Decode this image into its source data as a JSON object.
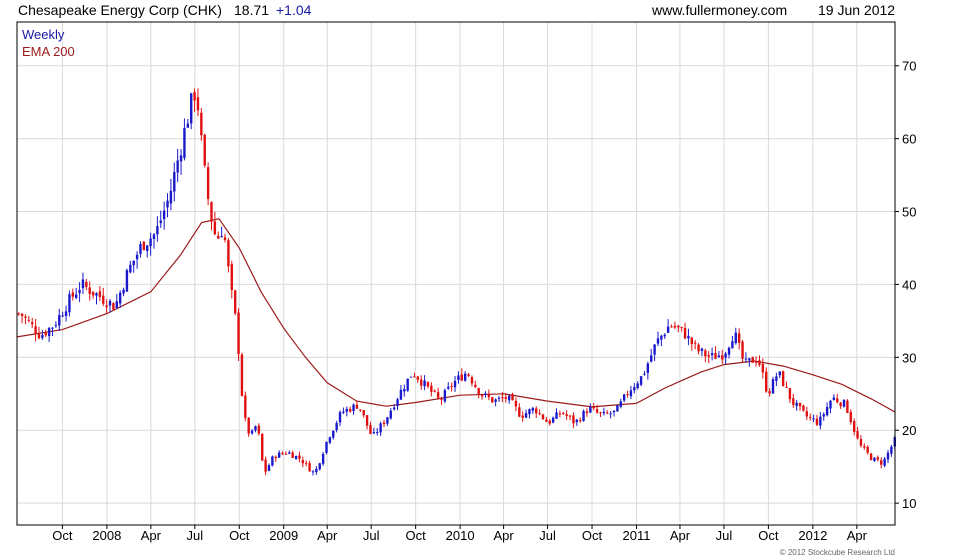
{
  "header": {
    "title": "Chesapeake Energy Corp (CHK)",
    "price": "18.71",
    "change": "+1.04",
    "site": "www.fullermoney.com",
    "date": "19 Jun 2012"
  },
  "legend": {
    "weekly": "Weekly",
    "ema": "EMA 200"
  },
  "copyright": "© 2012 Stockcube Research Ltd",
  "colors": {
    "up": "#1a1acc",
    "down": "#e01010",
    "ema": "#9b1b1b",
    "grid": "#d9d9d9"
  },
  "chart_data": {
    "type": "candlestick",
    "y_axis": {
      "position": "right",
      "ticks": [
        10,
        20,
        30,
        40,
        50,
        60,
        70
      ],
      "ylim": [
        7,
        76
      ]
    },
    "x_axis": {
      "ticks": [
        {
          "label": "Oct",
          "date": "2007-10-01"
        },
        {
          "label": "2008",
          "date": "2008-01-01"
        },
        {
          "label": "Apr",
          "date": "2008-04-01"
        },
        {
          "label": "Jul",
          "date": "2008-07-01"
        },
        {
          "label": "Oct",
          "date": "2008-10-01"
        },
        {
          "label": "2009",
          "date": "2009-01-01"
        },
        {
          "label": "Apr",
          "date": "2009-04-01"
        },
        {
          "label": "Jul",
          "date": "2009-07-01"
        },
        {
          "label": "Oct",
          "date": "2009-10-01"
        },
        {
          "label": "2010",
          "date": "2010-01-01"
        },
        {
          "label": "Apr",
          "date": "2010-04-01"
        },
        {
          "label": "Jul",
          "date": "2010-07-01"
        },
        {
          "label": "Oct",
          "date": "2010-10-01"
        },
        {
          "label": "2011",
          "date": "2011-01-01"
        },
        {
          "label": "Apr",
          "date": "2011-04-01"
        },
        {
          "label": "Jul",
          "date": "2011-07-01"
        },
        {
          "label": "Oct",
          "date": "2011-10-01"
        },
        {
          "label": "2012",
          "date": "2012-01-01"
        },
        {
          "label": "Apr",
          "date": "2012-04-01"
        }
      ],
      "range": [
        "2007-06-29",
        "2012-06-19"
      ]
    },
    "close_waypoints": [
      [
        "2007-07-06",
        36.0
      ],
      [
        "2007-08-17",
        33.0
      ],
      [
        "2007-09-14",
        34.5
      ],
      [
        "2007-10-12",
        37.5
      ],
      [
        "2007-11-09",
        40.0
      ],
      [
        "2007-12-14",
        38.5
      ],
      [
        "2008-01-18",
        37.0
      ],
      [
        "2008-02-15",
        42.0
      ],
      [
        "2008-03-14",
        45.5
      ],
      [
        "2008-04-11",
        47.0
      ],
      [
        "2008-05-09",
        52.0
      ],
      [
        "2008-05-30",
        58.0
      ],
      [
        "2008-06-20",
        64.0
      ],
      [
        "2008-07-04",
        67.0
      ],
      [
        "2008-07-18",
        57.0
      ],
      [
        "2008-08-01",
        50.0
      ],
      [
        "2008-08-15",
        46.0
      ],
      [
        "2008-08-29",
        48.0
      ],
      [
        "2008-09-12",
        40.0
      ],
      [
        "2008-09-26",
        34.0
      ],
      [
        "2008-10-10",
        22.0
      ],
      [
        "2008-10-24",
        19.0
      ],
      [
        "2008-11-07",
        21.0
      ],
      [
        "2008-11-21",
        14.0
      ],
      [
        "2008-12-12",
        16.5
      ],
      [
        "2009-01-09",
        17.0
      ],
      [
        "2009-02-06",
        16.0
      ],
      [
        "2009-03-06",
        14.0
      ],
      [
        "2009-04-03",
        19.0
      ],
      [
        "2009-05-01",
        22.5
      ],
      [
        "2009-06-05",
        23.5
      ],
      [
        "2009-07-03",
        19.0
      ],
      [
        "2009-07-31",
        21.5
      ],
      [
        "2009-08-28",
        25.0
      ],
      [
        "2009-09-25",
        28.0
      ],
      [
        "2009-10-23",
        26.0
      ],
      [
        "2009-11-20",
        24.0
      ],
      [
        "2009-12-18",
        26.5
      ],
      [
        "2010-01-15",
        28.0
      ],
      [
        "2010-02-12",
        25.0
      ],
      [
        "2010-03-12",
        24.0
      ],
      [
        "2010-04-09",
        24.5
      ],
      [
        "2010-05-07",
        22.0
      ],
      [
        "2010-06-04",
        23.0
      ],
      [
        "2010-07-02",
        21.0
      ],
      [
        "2010-07-30",
        22.5
      ],
      [
        "2010-08-27",
        21.0
      ],
      [
        "2010-09-24",
        23.0
      ],
      [
        "2010-10-22",
        22.0
      ],
      [
        "2010-11-19",
        22.5
      ],
      [
        "2010-12-17",
        25.5
      ],
      [
        "2011-01-14",
        27.5
      ],
      [
        "2011-02-11",
        32.0
      ],
      [
        "2011-03-11",
        34.5
      ],
      [
        "2011-04-08",
        33.5
      ],
      [
        "2011-05-06",
        31.0
      ],
      [
        "2011-06-03",
        30.0
      ],
      [
        "2011-07-01",
        30.5
      ],
      [
        "2011-07-22",
        33.5
      ],
      [
        "2011-08-12",
        29.0
      ],
      [
        "2011-09-09",
        30.0
      ],
      [
        "2011-09-30",
        25.0
      ],
      [
        "2011-10-21",
        28.0
      ],
      [
        "2011-11-18",
        24.0
      ],
      [
        "2011-12-16",
        22.0
      ],
      [
        "2012-01-13",
        21.0
      ],
      [
        "2012-02-10",
        24.5
      ],
      [
        "2012-03-09",
        23.5
      ],
      [
        "2012-04-06",
        18.0
      ],
      [
        "2012-05-04",
        16.0
      ],
      [
        "2012-05-25",
        15.5
      ],
      [
        "2012-06-19",
        18.71
      ]
    ],
    "ema_waypoints": [
      [
        "2007-06-29",
        32.8
      ],
      [
        "2007-10-01",
        33.8
      ],
      [
        "2008-01-01",
        36.0
      ],
      [
        "2008-04-01",
        39.0
      ],
      [
        "2008-06-01",
        44.0
      ],
      [
        "2008-07-15",
        48.5
      ],
      [
        "2008-08-20",
        49.0
      ],
      [
        "2008-10-01",
        45.0
      ],
      [
        "2008-11-15",
        39.0
      ],
      [
        "2009-01-01",
        34.0
      ],
      [
        "2009-02-15",
        30.0
      ],
      [
        "2009-04-01",
        26.5
      ],
      [
        "2009-06-01",
        24.0
      ],
      [
        "2009-08-01",
        23.3
      ],
      [
        "2009-10-01",
        23.8
      ],
      [
        "2010-01-01",
        24.8
      ],
      [
        "2010-04-01",
        25.0
      ],
      [
        "2010-07-01",
        24.0
      ],
      [
        "2010-10-01",
        23.2
      ],
      [
        "2011-01-01",
        23.7
      ],
      [
        "2011-03-01",
        25.8
      ],
      [
        "2011-05-15",
        28.0
      ],
      [
        "2011-07-01",
        29.0
      ],
      [
        "2011-09-01",
        29.5
      ],
      [
        "2011-11-01",
        28.8
      ],
      [
        "2012-01-01",
        27.6
      ],
      [
        "2012-03-01",
        26.3
      ],
      [
        "2012-05-01",
        24.3
      ],
      [
        "2012-06-19",
        22.5
      ]
    ]
  }
}
